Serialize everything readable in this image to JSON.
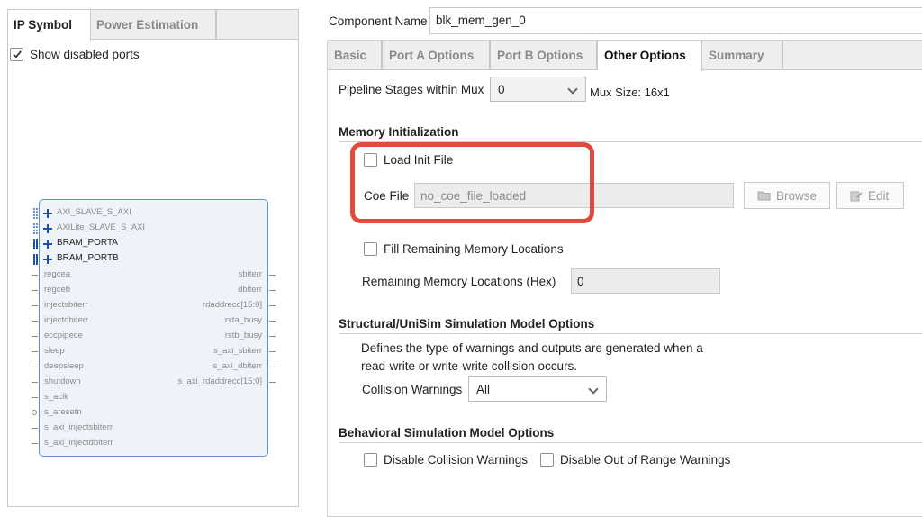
{
  "left_panel": {
    "tabs": [
      "IP Symbol",
      "Power Estimation"
    ],
    "show_disabled_label": "Show disabled ports",
    "show_disabled_checked": true,
    "interfaces": [
      "AXI_SLAVE_S_AXI",
      "AXILite_SLAVE_S_AXI",
      "BRAM_PORTA",
      "BRAM_PORTB"
    ],
    "left_ports": [
      "regcea",
      "regceb",
      "injectsbiterr",
      "injectdbiterr",
      "eccpipece",
      "sleep",
      "deepsleep",
      "shutdown",
      "s_aclk",
      "s_aresetn",
      "s_axi_injectsbiterr",
      "s_axi_injectdbiterr"
    ],
    "right_ports": [
      "sbiterr",
      "dbiterr",
      "rdaddrecc[15:0]",
      "rsta_busy",
      "rstb_busy",
      "s_axi_sbiterr",
      "s_axi_dbiterr",
      "s_axi_rdaddrecc[15:0]"
    ]
  },
  "component": {
    "label": "Component Name",
    "value": "blk_mem_gen_0"
  },
  "tabs": [
    "Basic",
    "Port A Options",
    "Port B Options",
    "Other Options",
    "Summary"
  ],
  "active_tab": "Other Options",
  "pipeline": {
    "label": "Pipeline Stages within Mux",
    "value": "0",
    "mux_size": "Mux Size: 16x1"
  },
  "memory_init": {
    "title": "Memory Initialization",
    "load_init_label": "Load Init File",
    "load_init_checked": false,
    "coe_label": "Coe File",
    "coe_value": "no_coe_file_loaded",
    "browse_label": "Browse",
    "edit_label": "Edit",
    "fill_label": "Fill Remaining Memory Locations",
    "fill_checked": false,
    "remaining_label": "Remaining Memory Locations (Hex)",
    "remaining_value": "0"
  },
  "structural": {
    "title": "Structural/UniSim Simulation Model Options",
    "desc_line1": "Defines the type of warnings and outputs are generated when a",
    "desc_line2": "read-write or write-write collision occurs.",
    "collision_label": "Collision Warnings",
    "collision_value": "All"
  },
  "behavioral": {
    "title": "Behavioral Simulation Model Options",
    "disable_collision_label": "Disable Collision Warnings",
    "disable_collision_checked": false,
    "disable_range_label": "Disable Out of Range Warnings",
    "disable_range_checked": false
  },
  "colors": {
    "highlight": "#e14a3c",
    "accent_blue": "#1f4fa3"
  }
}
